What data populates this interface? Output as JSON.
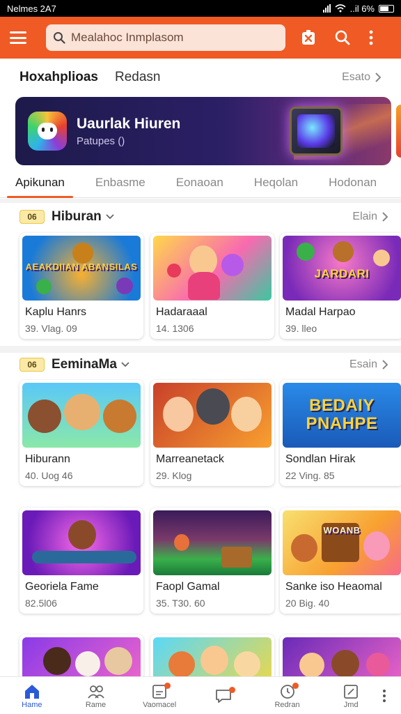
{
  "status_bar": {
    "carrier_time": "Nelmes 2A7",
    "signal_text": "..il 6%"
  },
  "app_bar": {
    "search_placeholder": "Mealahoc Inmplasom",
    "icons": [
      "menu-icon",
      "search-icon",
      "gift-tag-icon",
      "search-icon",
      "more-vertical-icon"
    ]
  },
  "header": {
    "title": "Hoxahplioas",
    "subtitle": "Redasn",
    "more_label": "Esato"
  },
  "banner": {
    "title": "Uaurlak Hiuren",
    "subtitle": "Patupes ()"
  },
  "tabs": [
    {
      "label": "Apikunan",
      "active": true
    },
    {
      "label": "Enbasme",
      "active": false
    },
    {
      "label": "Eonaoan",
      "active": false
    },
    {
      "label": "Heqolan",
      "active": false
    },
    {
      "label": "Hodonan",
      "active": false
    }
  ],
  "sections": [
    {
      "badge": "06",
      "name": "Hiburan",
      "more_label": "Elain",
      "cards": [
        {
          "name": "Kaplu Hanrs",
          "meta": "39. Vlag. 09",
          "art_text": "AEAKDIIAN ABANSILAS"
        },
        {
          "name": "Hadaraaal",
          "meta": "14. 1306",
          "art_text": ""
        },
        {
          "name": "Madal Harpao",
          "meta": "39. lleo",
          "art_text": "JARDARI"
        }
      ]
    },
    {
      "badge": "06",
      "name": "EeminaMa",
      "more_label": "Esain",
      "cards": [
        {
          "name": "Hiburann",
          "meta": "40. Uog 46",
          "art_text": ""
        },
        {
          "name": "Marreanetack",
          "meta": "29. Klog",
          "art_text": ""
        },
        {
          "name": "Sondlan Hirak",
          "meta": "22 Ving. 85",
          "art_text": "BEDAIY PNAHPE"
        },
        {
          "name": "Georiela Fame",
          "meta": "82.5l06",
          "art_text": ""
        },
        {
          "name": "Faopl Gamal",
          "meta": "35. T30. 60",
          "art_text": ""
        },
        {
          "name": "Sanke iso Heaomal",
          "meta": "20 Big. 40",
          "art_text": "WOANB"
        }
      ]
    }
  ],
  "bottom_nav": [
    {
      "label": "Hame",
      "icon": "home-icon",
      "active": true
    },
    {
      "label": "Rame",
      "icon": "people-icon",
      "active": false
    },
    {
      "label": "Vaomacel",
      "icon": "note-icon",
      "active": false
    },
    {
      "label": "",
      "icon": "chat-icon",
      "active": false
    },
    {
      "label": "Redran",
      "icon": "clock-icon",
      "active": false
    },
    {
      "label": "Jmd",
      "icon": "edit-icon",
      "active": false
    }
  ],
  "colors": {
    "accent": "#f05a24",
    "nav_active": "#2a5ad8"
  }
}
